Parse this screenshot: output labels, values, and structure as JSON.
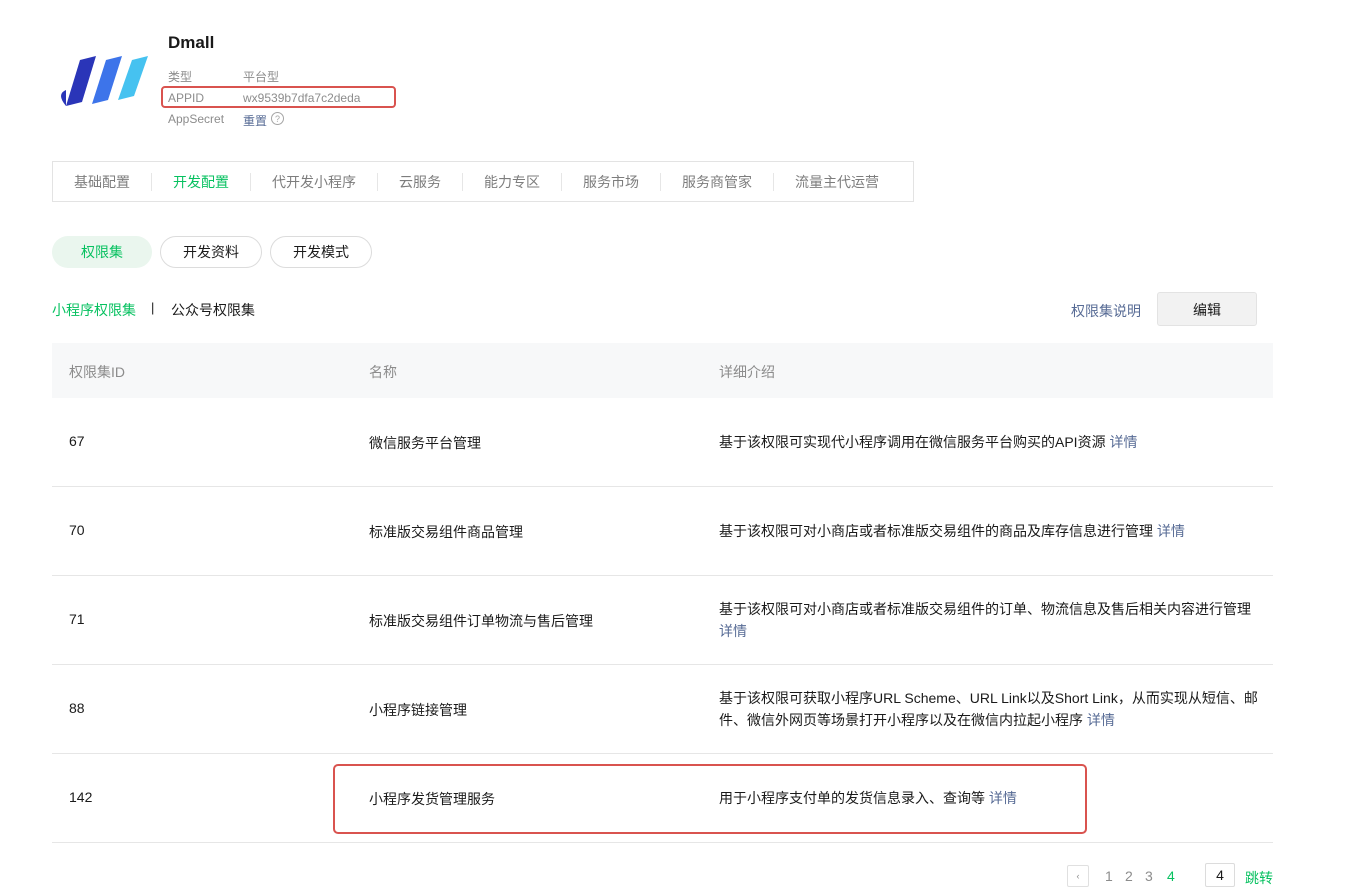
{
  "app": {
    "name": "Dmall",
    "type_label": "类型",
    "type_value": "平台型",
    "appid_label": "APPID",
    "appid_value": "wx9539b7dfa7c2deda",
    "secret_label": "AppSecret",
    "secret_action": "重置",
    "help_glyph": "?"
  },
  "main_tabs": [
    {
      "label": "基础配置"
    },
    {
      "label": "开发配置",
      "active": true
    },
    {
      "label": "代开发小程序"
    },
    {
      "label": "云服务"
    },
    {
      "label": "能力专区"
    },
    {
      "label": "服务市场"
    },
    {
      "label": "服务商管家"
    },
    {
      "label": "流量主代运营"
    }
  ],
  "pills": [
    "权限集",
    "开发资料",
    "开发模式"
  ],
  "sub_tabs": {
    "miniprogram": "小程序权限集",
    "separator": "|",
    "official": "公众号权限集"
  },
  "actions": {
    "explain": "权限集说明",
    "edit": "编辑"
  },
  "table": {
    "headers": [
      "权限集ID",
      "名称",
      "详细介绍"
    ],
    "detail_label": "详情",
    "rows": [
      {
        "id": "67",
        "name": "微信服务平台管理",
        "desc": "基于该权限可实现代小程序调用在微信服务平台购买的API资源"
      },
      {
        "id": "70",
        "name": "标准版交易组件商品管理",
        "desc": "基于该权限可对小商店或者标准版交易组件的商品及库存信息进行管理"
      },
      {
        "id": "71",
        "name": "标准版交易组件订单物流与售后管理",
        "desc": "基于该权限可对小商店或者标准版交易组件的订单、物流信息及售后相关内容进行管理"
      },
      {
        "id": "88",
        "name": "小程序链接管理",
        "desc": "基于该权限可获取小程序URL Scheme、URL Link以及Short Link，从而实现从短信、邮件、微信外网页等场景打开小程序以及在微信内拉起小程序"
      },
      {
        "id": "142",
        "name": "小程序发货管理服务",
        "desc": "用于小程序支付单的发货信息录入、查询等"
      }
    ]
  },
  "pagination": {
    "prev_glyph": "‹",
    "pages": [
      "1",
      "2",
      "3",
      "4"
    ],
    "current": "4",
    "input_value": "4",
    "jump_label": "跳转"
  },
  "colors": {
    "accent": "#07c160",
    "link": "#576b95",
    "highlight": "#d9534f"
  }
}
